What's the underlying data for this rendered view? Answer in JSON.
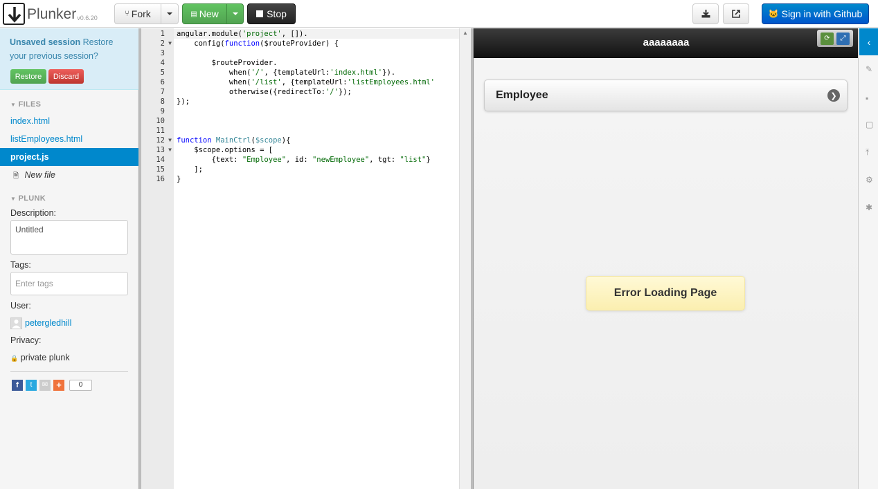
{
  "app": {
    "name": "Plunker",
    "version": "v0.6.20"
  },
  "toolbar": {
    "fork_label": "Fork",
    "new_label": "New",
    "stop_label": "Stop",
    "signin_label": "Sign in with Github"
  },
  "session": {
    "title": "Unsaved session",
    "message": "Restore your previous session?",
    "restore_label": "Restore",
    "discard_label": "Discard"
  },
  "files": {
    "header": "FILES",
    "items": [
      {
        "name": "index.html",
        "active": false
      },
      {
        "name": "listEmployees.html",
        "active": false
      },
      {
        "name": "project.js",
        "active": true
      }
    ],
    "new_file_label": "New file"
  },
  "plunk": {
    "header": "PLUNK",
    "description_label": "Description:",
    "description_value": "Untitled",
    "tags_label": "Tags:",
    "tags_placeholder": "Enter tags",
    "user_label": "User:",
    "user_name": "petergledhill",
    "privacy_label": "Privacy:",
    "privacy_value": "private plunk",
    "share_count": "0"
  },
  "editor": {
    "lines": [
      {
        "n": "1",
        "fold": false,
        "html": "angular.module(<span class=\"str\">'project'</span>, []).",
        "highlight": true
      },
      {
        "n": "2",
        "fold": true,
        "html": "    config(<span class=\"kw\">function</span>($routeProvider) {",
        "highlight": false
      },
      {
        "n": "3",
        "fold": false,
        "html": "",
        "highlight": false
      },
      {
        "n": "4",
        "fold": false,
        "html": "        $routeProvider.",
        "highlight": false
      },
      {
        "n": "5",
        "fold": false,
        "html": "            when(<span class=\"str\">'/'</span>, {templateUrl:<span class=\"str\">'index.html'</span>}).",
        "highlight": false
      },
      {
        "n": "6",
        "fold": false,
        "html": "            when(<span class=\"str\">'/list'</span>, {templateUrl:<span class=\"str\">'listEmployees.html'</span>",
        "highlight": false
      },
      {
        "n": "7",
        "fold": false,
        "html": "            otherwise({redirectTo:<span class=\"str\">'/'</span>});",
        "highlight": false
      },
      {
        "n": "8",
        "fold": false,
        "html": "});",
        "highlight": false
      },
      {
        "n": "9",
        "fold": false,
        "html": "",
        "highlight": false
      },
      {
        "n": "10",
        "fold": false,
        "html": "",
        "highlight": false
      },
      {
        "n": "11",
        "fold": false,
        "html": "",
        "highlight": false
      },
      {
        "n": "12",
        "fold": true,
        "html": "<span class=\"kw\">function</span> <span class=\"var\">MainCtrl</span>(<span class=\"var\">$scope</span>){",
        "highlight": false
      },
      {
        "n": "13",
        "fold": true,
        "html": "    $scope.options = [",
        "highlight": false
      },
      {
        "n": "14",
        "fold": false,
        "html": "        {text: <span class=\"str\">\"Employee\"</span>, id: <span class=\"str\">\"newEmployee\"</span>, tgt: <span class=\"str\">\"list\"</span>}",
        "highlight": false
      },
      {
        "n": "15",
        "fold": false,
        "html": "    ];",
        "highlight": false
      },
      {
        "n": "16",
        "fold": false,
        "html": "}",
        "highlight": false
      }
    ]
  },
  "preview": {
    "title": "aaaaaaaa",
    "list_item": "Employee",
    "error_message": "Error Loading Page"
  },
  "colors": {
    "accent": "#0088cc",
    "green": "#51a351",
    "red": "#da4f49",
    "info_bg": "#d9edf7"
  }
}
